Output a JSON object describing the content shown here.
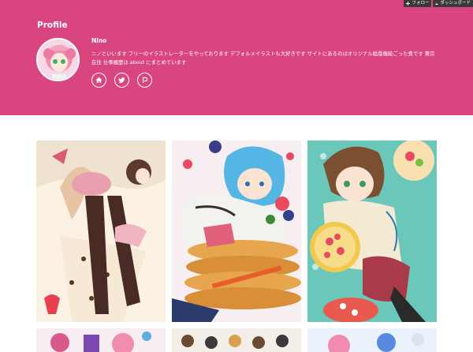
{
  "toolbar": {
    "follow_label": "フォロー",
    "dashboard_label": "ダッシュボード"
  },
  "profile": {
    "heading": "Profile",
    "name": "Nino",
    "bio": "ニノといいます フリーのイラストレーターをやっております デフォルメイラストも大好きです サイトにあるのはオリジナル絵版権絵ごった煮です 東京在住 仕事履歴は about にまとめています",
    "socials": [
      {
        "icon": "home-icon"
      },
      {
        "icon": "twitter-icon"
      },
      {
        "icon": "pixiv-icon"
      }
    ]
  },
  "colors": {
    "header_bg": "#d8457f",
    "toolbar_bg": "#3a3a3a",
    "text": "#ffffff"
  },
  "gallery": {
    "items": [
      {
        "name": "gallery-image-strawberry-cake-girl"
      },
      {
        "name": "gallery-image-pancake-girl"
      },
      {
        "name": "gallery-image-fruit-tart-girl"
      },
      {
        "name": "gallery-image-row2-1"
      },
      {
        "name": "gallery-image-row2-2"
      },
      {
        "name": "gallery-image-row2-3"
      }
    ]
  }
}
